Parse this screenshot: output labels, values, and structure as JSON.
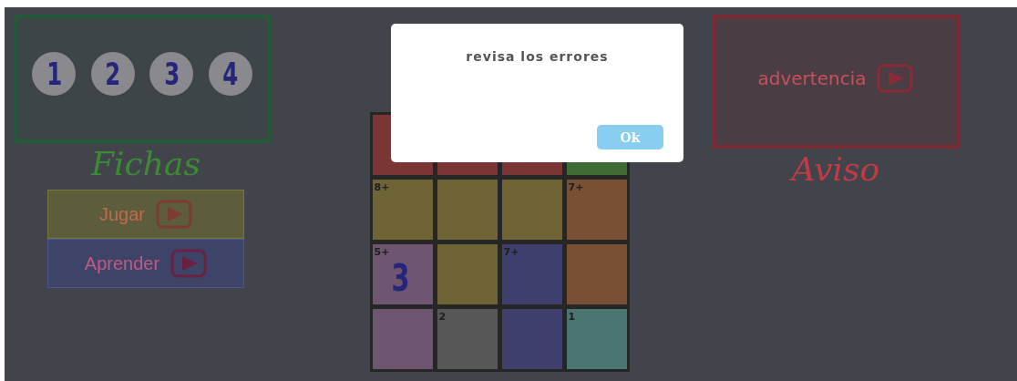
{
  "chips": {
    "items": [
      "1",
      "2",
      "3",
      "4"
    ],
    "caption": "Fichas"
  },
  "actions": [
    {
      "label": "Jugar",
      "kind": "play"
    },
    {
      "label": "Aprender",
      "kind": "learn"
    }
  ],
  "board": {
    "rows": [
      [
        {
          "color": "#7a3535"
        },
        {
          "color": "#7a3535"
        },
        {
          "color": "#7a3535"
        },
        {
          "color": "#3f6b35"
        }
      ],
      [
        {
          "color": "#6e6435",
          "label": "8+"
        },
        {
          "color": "#6e6435"
        },
        {
          "color": "#6e6435"
        },
        {
          "color": "#7a5034",
          "label": "7+"
        }
      ],
      [
        {
          "color": "#6e5570",
          "label": "5+",
          "value": "3"
        },
        {
          "color": "#6e6435"
        },
        {
          "color": "#3f3f6e",
          "label": "7+"
        },
        {
          "color": "#7a5034"
        }
      ],
      [
        {
          "color": "#6e5570"
        },
        {
          "color": "#575757",
          "label": "2"
        },
        {
          "color": "#3f3f6e"
        },
        {
          "color": "#4a7570",
          "label": "1"
        }
      ]
    ]
  },
  "warning": {
    "label": "advertencia",
    "caption": "Aviso"
  },
  "dialog": {
    "message": "revisa los errores",
    "button": "Ok"
  }
}
